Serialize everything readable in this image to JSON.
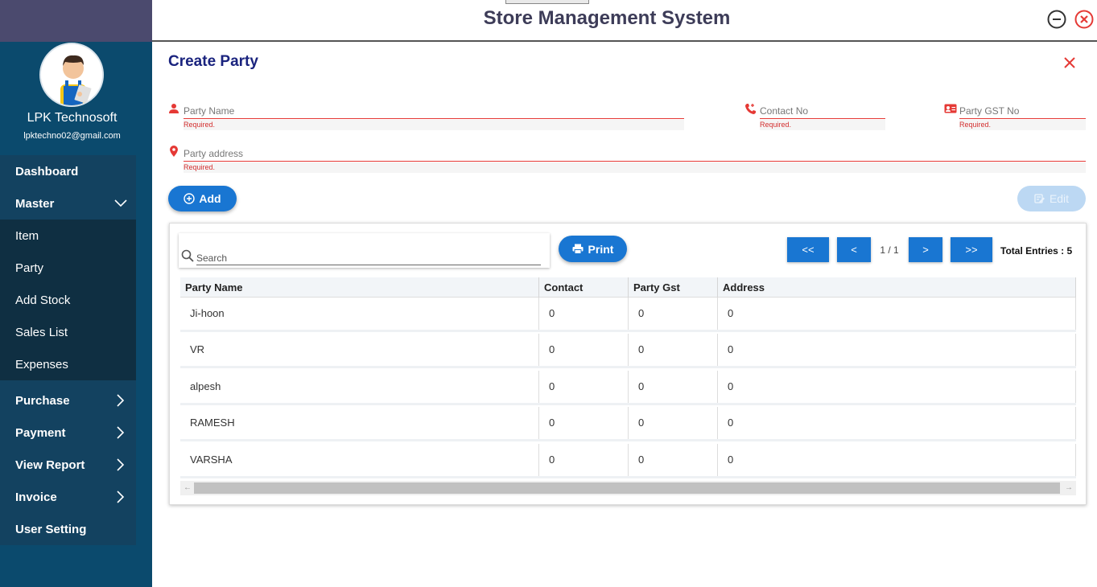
{
  "app": {
    "title": "Store Management System"
  },
  "sidebar": {
    "company_name": "LPK Technosoft",
    "company_email": "lpktechno02@gmail.com",
    "items": [
      {
        "label": "Dashboard"
      },
      {
        "label": "Master"
      },
      {
        "label": "Purchase"
      },
      {
        "label": "Payment"
      },
      {
        "label": "View Report"
      },
      {
        "label": "Invoice"
      },
      {
        "label": "User Setting"
      }
    ],
    "master_submenu": [
      {
        "label": "Item"
      },
      {
        "label": "Party"
      },
      {
        "label": "Add Stock"
      },
      {
        "label": "Sales List"
      },
      {
        "label": "Expenses"
      }
    ]
  },
  "form": {
    "title": "Create Party",
    "party_name": {
      "placeholder": "Party Name",
      "error": "Required."
    },
    "contact_no": {
      "placeholder": "Contact No",
      "error": "Required."
    },
    "party_gst": {
      "placeholder": "Party GST No",
      "error": "Required."
    },
    "party_address": {
      "placeholder": "Party address",
      "error": "Required."
    },
    "add_label": "Add",
    "edit_label": "Edit"
  },
  "table": {
    "search_placeholder": "Search",
    "print_label": "Print",
    "pagination": {
      "first": "<<",
      "prev": "<",
      "page": "1 / 1",
      "next": ">",
      "last": ">>"
    },
    "total_entries": "Total Entries : 5",
    "columns": [
      "Party Name",
      "Contact",
      "Party Gst",
      "Address"
    ],
    "rows": [
      [
        "Ji-hoon",
        "0",
        "0",
        "0"
      ],
      [
        "VR",
        "0",
        "0",
        "0"
      ],
      [
        "alpesh",
        "0",
        "0",
        "0"
      ],
      [
        "RAMESH",
        "0",
        "0",
        "0"
      ],
      [
        "VARSHA",
        "0",
        "0",
        "0"
      ]
    ]
  },
  "colors": {
    "primary": "#1976d2",
    "sidebar": "#0b4a6d",
    "error": "#e53935",
    "title": "#1a237e"
  }
}
